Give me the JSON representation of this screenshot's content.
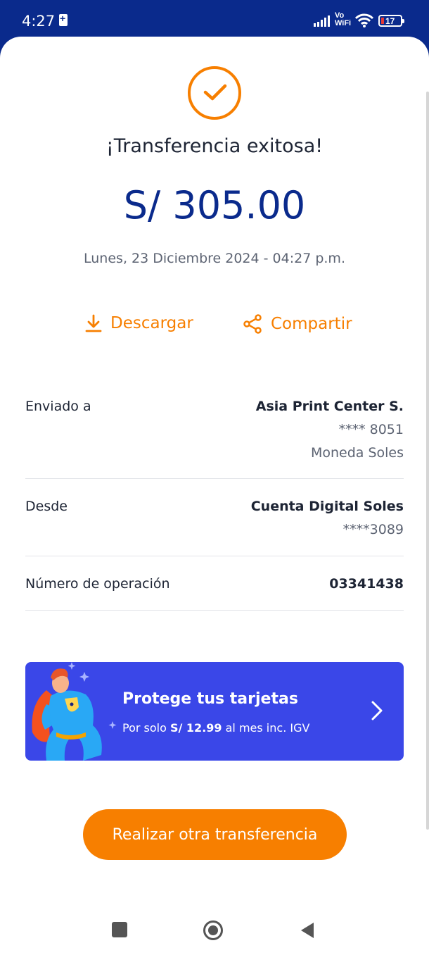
{
  "status_bar": {
    "time": "4:27",
    "network_label_line1": "Vo",
    "network_label_line2": "WiFi",
    "battery_percent": "17"
  },
  "receipt": {
    "title": "¡Transferencia exitosa!",
    "amount": "S/ 305.00",
    "datetime": "Lunes, 23 Diciembre 2024 - 04:27 p.m."
  },
  "actions": {
    "download_label": "Descargar",
    "share_label": "Compartir"
  },
  "details": {
    "sent_to": {
      "label": "Enviado a",
      "name": "Asia Print Center S.",
      "account": "**** 8051",
      "currency": "Moneda Soles"
    },
    "from": {
      "label": "Desde",
      "account_name": "Cuenta Digital Soles",
      "account": "****3089"
    },
    "operation": {
      "label": "Número de operación",
      "number": "03341438"
    }
  },
  "promo": {
    "title": "Protege tus tarjetas",
    "subtitle_prefix": "Por solo ",
    "subtitle_price": "S/ 12.99",
    "subtitle_suffix": " al mes inc. IGV"
  },
  "cta": {
    "label": "Realizar otra transferencia"
  },
  "colors": {
    "brand_blue": "#0a2a8c",
    "accent_orange": "#f77f00",
    "promo_blue": "#3a47e8"
  }
}
